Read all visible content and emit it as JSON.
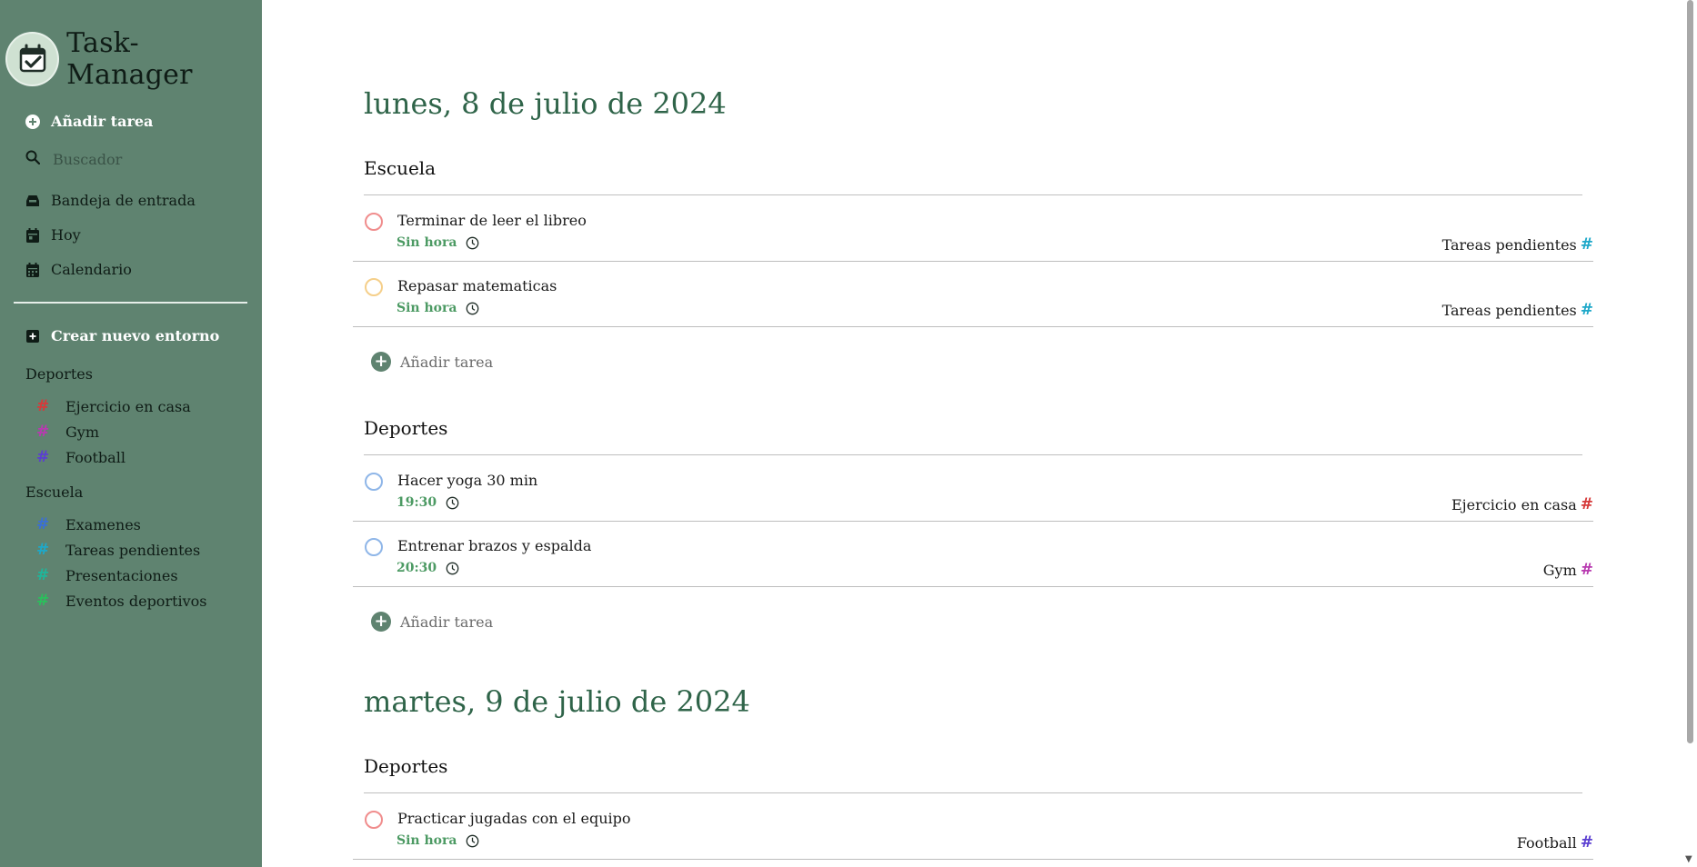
{
  "app": {
    "title": "Task-Manager",
    "brand_color": "#5f8370",
    "accent_green": "#2f6449"
  },
  "sidebar": {
    "add_task_label": "Añadir tarea",
    "search": {
      "placeholder": "Buscador",
      "value": ""
    },
    "nav": [
      {
        "label": "Bandeja de entrada",
        "icon": "inbox-icon"
      },
      {
        "label": "Hoy",
        "icon": "calendar-day-icon"
      },
      {
        "label": "Calendario",
        "icon": "calendar-icon"
      }
    ],
    "create_env_label": "Crear nuevo entorno",
    "groups": [
      {
        "title": "Deportes",
        "tags": [
          {
            "label": "Ejercicio en casa",
            "color": "#d63a3a"
          },
          {
            "label": "Gym",
            "color": "#b83ab0"
          },
          {
            "label": "Football",
            "color": "#5b3fd1"
          }
        ]
      },
      {
        "title": "Escuela",
        "tags": [
          {
            "label": "Examenes",
            "color": "#3a6fd6"
          },
          {
            "label": "Tareas pendientes",
            "color": "#1ea8c9"
          },
          {
            "label": "Presentaciones",
            "color": "#1fb59a"
          },
          {
            "label": "Eventos deportivos",
            "color": "#2bbf5c"
          }
        ]
      }
    ]
  },
  "main": {
    "days": [
      {
        "title": "lunes, 8 de julio de 2024",
        "sections": [
          {
            "title": "Escuela",
            "tasks": [
              {
                "name": "Terminar de leer el libreo",
                "time": "Sin hora",
                "tag": "Tareas pendientes",
                "tag_color": "#1ea8c9",
                "circle_color": "#f08d8d"
              },
              {
                "name": "Repasar matematicas",
                "time": "Sin hora",
                "tag": "Tareas pendientes",
                "tag_color": "#1ea8c9",
                "circle_color": "#f5cf8a"
              }
            ],
            "add_label": "Añadir tarea"
          },
          {
            "title": "Deportes",
            "tasks": [
              {
                "name": "Hacer yoga 30 min",
                "time": "19:30",
                "tag": "Ejercicio en casa",
                "tag_color": "#d63a3a",
                "circle_color": "#8fb6e8"
              },
              {
                "name": "Entrenar brazos y espalda",
                "time": "20:30",
                "tag": "Gym",
                "tag_color": "#b83ab0",
                "circle_color": "#8fb6e8"
              }
            ],
            "add_label": "Añadir tarea"
          }
        ]
      },
      {
        "title": "martes, 9 de julio de 2024",
        "sections": [
          {
            "title": "Deportes",
            "tasks": [
              {
                "name": "Practicar jugadas con el equipo",
                "time": "Sin hora",
                "tag": "Football",
                "tag_color": "#5b3fd1",
                "circle_color": "#f08d8d"
              }
            ]
          }
        ]
      }
    ]
  }
}
